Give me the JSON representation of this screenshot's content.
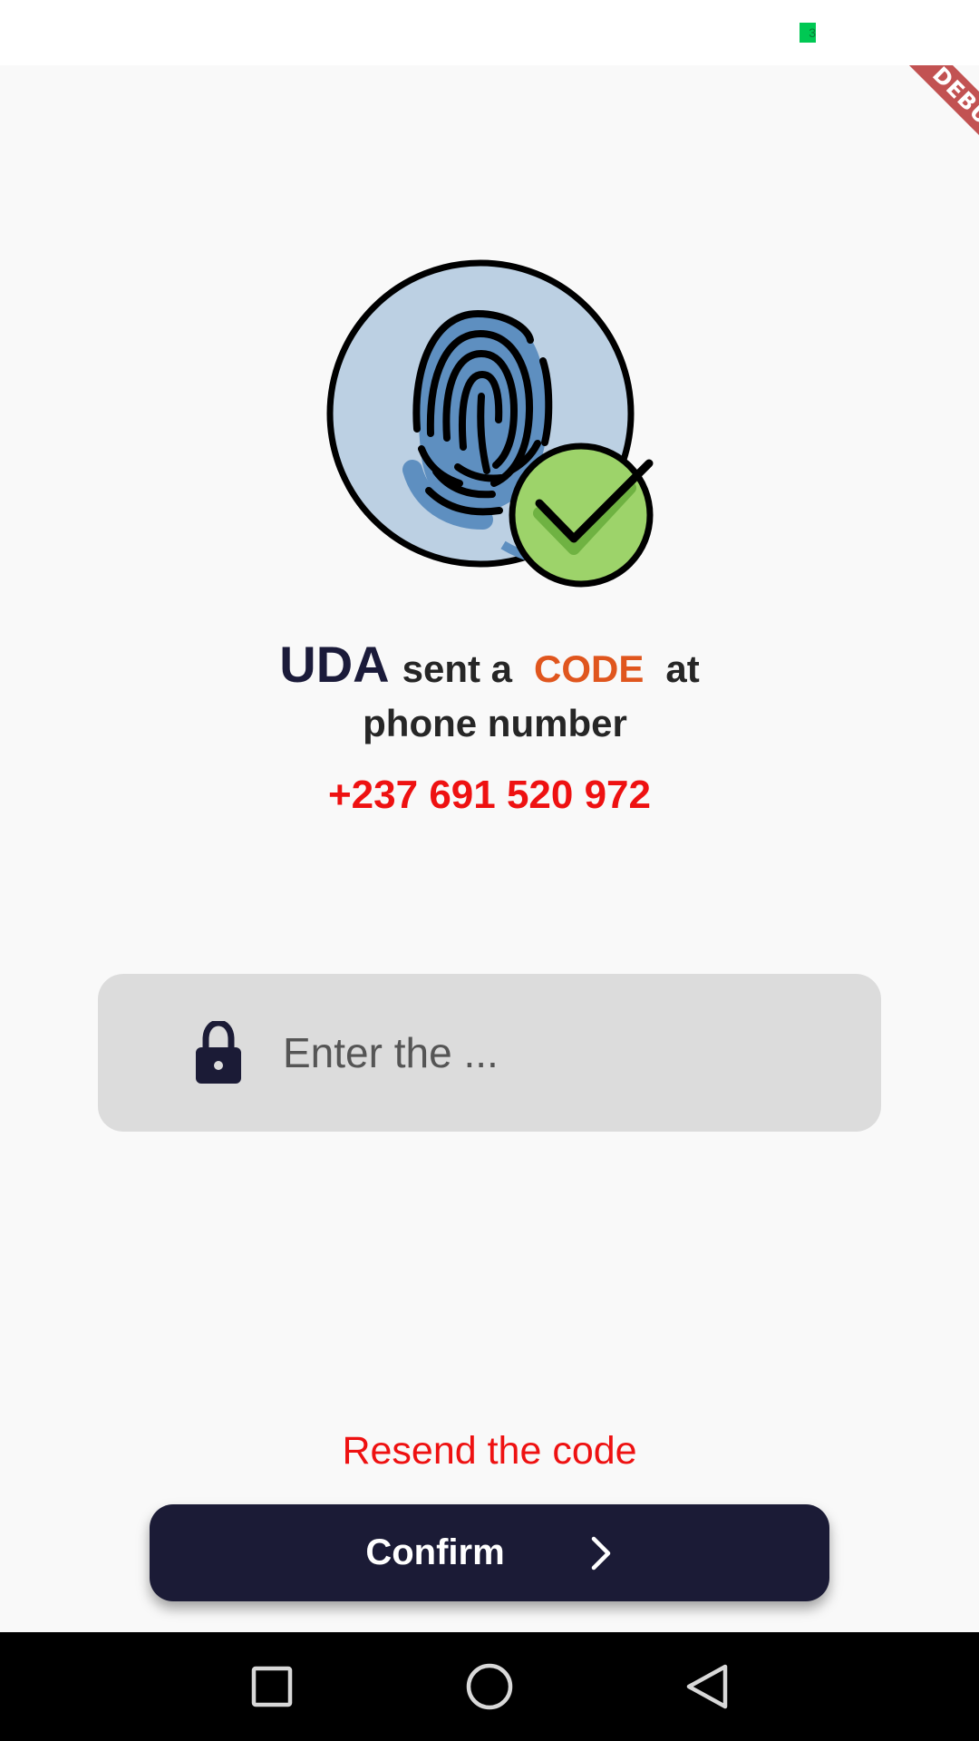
{
  "status_bar": {
    "indicator_text": "3",
    "indicator_color": "#00c853"
  },
  "debug_banner": {
    "label": "DEBUG"
  },
  "illustration": {
    "icon": "fingerprint-verified-icon"
  },
  "heading": {
    "brand": "UDA",
    "text_before_code": "sent a",
    "code_word": "CODE",
    "text_after_code": "at",
    "line2": "phone number"
  },
  "phone_number": "+237 691 520 972",
  "code_field": {
    "placeholder": "Enter the ...",
    "value": "",
    "icon": "lock-icon"
  },
  "resend_link": "Resend the code",
  "confirm_button": {
    "label": "Confirm",
    "icon": "chevron-right-icon"
  },
  "nav_bar": {
    "buttons": [
      "recent-apps",
      "home",
      "back"
    ]
  },
  "colors": {
    "brand_dark": "#1b1b36",
    "accent_orange": "#e0561e",
    "accent_red": "#ee1111",
    "field_background": "#dcdcdc"
  }
}
